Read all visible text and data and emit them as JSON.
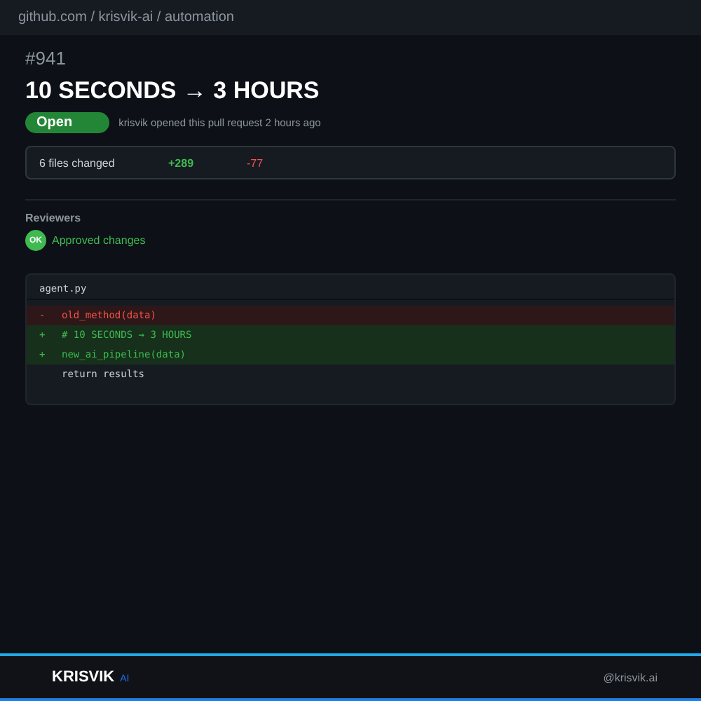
{
  "breadcrumb": "github.com / krisvik-ai / automation",
  "pull_request": {
    "number": "#941",
    "title": "10 SECONDS → 3 HOURS",
    "status": "Open",
    "meta": "krisvik opened this pull request 2 hours ago"
  },
  "summary": {
    "files": "6 files changed",
    "additions": "+289",
    "deletions": "-77"
  },
  "reviewers": {
    "heading": "Reviewers",
    "badge": "OK",
    "status": "Approved changes"
  },
  "diff": {
    "filename": "agent.py",
    "lines": [
      {
        "kind": "del",
        "sign": "-",
        "code": "old_method(data)"
      },
      {
        "kind": "add",
        "sign": "+",
        "code": "# 10 SECONDS → 3 HOURS"
      },
      {
        "kind": "add",
        "sign": "+",
        "code": "new_ai_pipeline(data)"
      },
      {
        "kind": "ctx",
        "code": "return results"
      }
    ]
  },
  "footer": {
    "brand": "KRISVIK",
    "brand_suffix": "AI",
    "handle": "@krisvik.ai"
  }
}
